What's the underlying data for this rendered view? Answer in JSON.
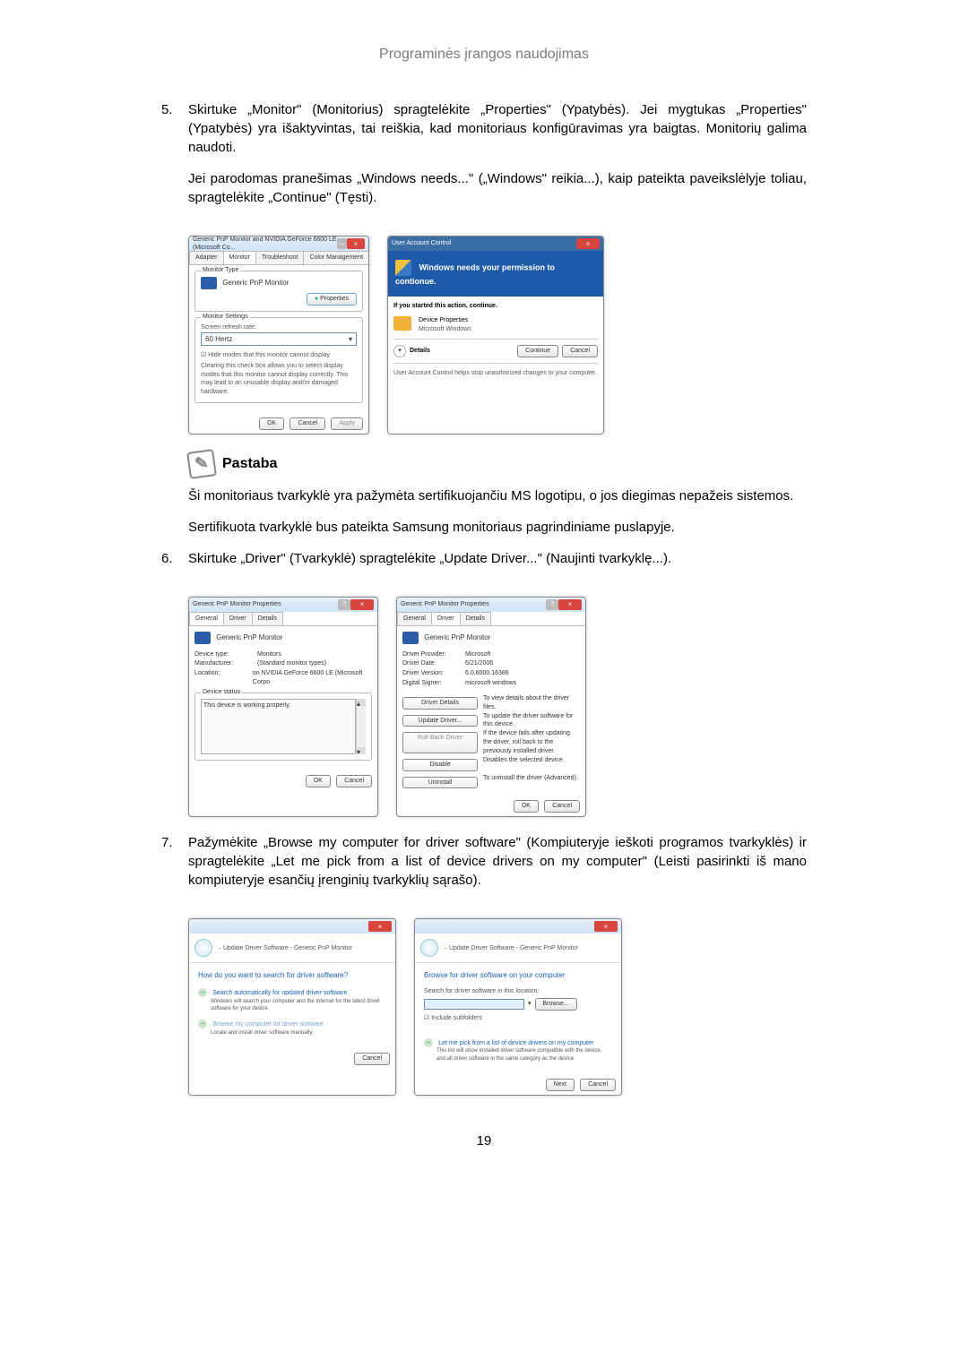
{
  "header": "Programinės įrangos naudojimas",
  "items": {
    "i5": {
      "num": "5.",
      "p1": "Skirtuke „Monitor\" (Monitorius) spragtelėkite „Properties\" (Ypatybės). Jei mygtukas „Properties\" (Ypatybės) yra išaktyvintas, tai reiškia, kad monitoriaus konfigūravimas yra baigtas. Monitorių galima naudoti.",
      "p2": "Jei parodomas pranešimas „Windows needs...\" („Windows\" reikia...), kaip pateikta paveikslėlyje toliau, spragtelėkite „Continue\" (Tęsti)."
    },
    "i6": {
      "num": "6.",
      "p1": "Skirtuke „Driver\" (Tvarkyklė) spragtelėkite „Update Driver...\" (Naujinti tvarkyklę...)."
    },
    "i7": {
      "num": "7.",
      "p1": "Pažymėkite „Browse my computer for driver software\" (Kompiuteryje ieškoti programos tvarkyklės) ir spragtelėkite „Let me pick from a list of device drivers on my computer\" (Leisti pasirinkti iš mano kompiuteryje esančių įrenginių tvarkyklių sąrašo)."
    }
  },
  "note": {
    "label": "Pastaba",
    "p1": "Ši monitoriaus tvarkyklė yra pažymėta sertifikuojančiu MS logotipu, o jos diegimas nepažeis sistemos.",
    "p2": "Sertifikuota tvarkyklė bus pateikta Samsung monitoriaus pagrindiniame puslapyje."
  },
  "dlg1": {
    "title": "Generic PnP Monitor and NVIDIA GeForce 6600 LE (Microsoft Co...",
    "tabs": [
      "Adapter",
      "Monitor",
      "Troubleshoot",
      "Color Management"
    ],
    "monitorType": "Monitor Type",
    "monitorName": "Generic PnP Monitor",
    "btnProperties": "Properties",
    "monitorSettings": "Monitor Settings",
    "refreshLabel": "Screen refresh rate:",
    "refreshValue": "60 Hertz",
    "hideModes": "Hide modes that this monitor cannot display",
    "hideModesDesc": "Clearing this check box allows you to select display modes that this monitor cannot display correctly. This may lead to an unusable display and/or damaged hardware.",
    "ok": "OK",
    "cancel": "Cancel",
    "apply": "Apply"
  },
  "uac": {
    "title": "User Account Control",
    "banner": "Windows needs your permission to contionue.",
    "started": "If you started this action, continue.",
    "prog": "Device Properties",
    "vendor": "Microsoft Windows",
    "details": "Details",
    "continue": "Continue",
    "cancel": "Cancel",
    "footer": "User Account Control helps stop unauthorized changes to your computer."
  },
  "props_general": {
    "title": "Generic PnP Monitor Properties",
    "tabs": [
      "General",
      "Driver",
      "Details"
    ],
    "name": "Generic PnP Monitor",
    "devtype_l": "Device type:",
    "devtype_v": "Monitors",
    "manu_l": "Manufacturer:",
    "manu_v": "(Standard monitor types)",
    "loc_l": "Location:",
    "loc_v": "on NVIDIA GeForce 6600 LE (Microsoft Corpo",
    "status_l": "Device status",
    "status_v": "This device is working properly.",
    "ok": "OK",
    "cancel": "Cancel"
  },
  "props_driver": {
    "title": "Generic PnP Monitor Properties",
    "tabs": [
      "General",
      "Driver",
      "Details"
    ],
    "name": "Generic PnP Monitor",
    "prov_l": "Driver Provider:",
    "prov_v": "Microsoft",
    "date_l": "Driver Date:",
    "date_v": "6/21/2006",
    "ver_l": "Driver Version:",
    "ver_v": "6.0.6000.16386",
    "sign_l": "Digital Signer:",
    "sign_v": "microsoft windows",
    "btn_details": "Driver Details",
    "btn_details_d": "To view details about the driver files.",
    "btn_update": "Update Driver...",
    "btn_update_d": "To update the driver software for this device.",
    "btn_roll": "Roll Back Driver",
    "btn_roll_d": "If the device fails after updating the driver, roll back to the previously installed driver.",
    "btn_disable": "Disable",
    "btn_disable_d": "Disables the selected device.",
    "btn_uninstall": "Uninstall",
    "btn_uninstall_d": "To uninstall the driver (Advanced).",
    "ok": "OK",
    "cancel": "Cancel"
  },
  "wiz1": {
    "crumb": "Update Driver Software - Generic PnP Monitor",
    "q": "How do you want to search for driver software?",
    "opt1_t": "Search automatically for updated driver software",
    "opt1_d": "Windows will search your computer and the Internet for the latest driver software for your device.",
    "opt2_t": "Browse my computer for driver software",
    "opt2_d": "Locate and install driver software manually.",
    "cancel": "Cancel"
  },
  "wiz2": {
    "crumb": "Update Driver Software - Generic PnP Monitor",
    "q": "Browse for driver software on your computer",
    "loc_l": "Search for driver software in this location:",
    "browse": "Browse...",
    "include": "Include subfolders",
    "opt_t": "Let me pick from a list of device drivers on my computer",
    "opt_d": "This list will show installed driver software compatible with the device, and all driver software in the same category as the device.",
    "next": "Next",
    "cancel": "Cancel"
  },
  "pagenum": "19"
}
